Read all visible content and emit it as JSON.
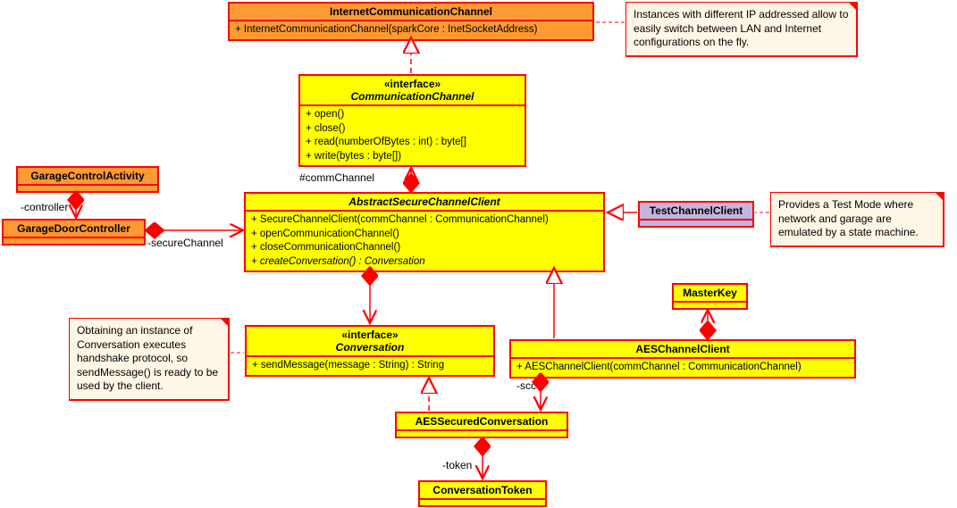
{
  "notes": {
    "ipNote": "Instances with different IP addressed allow to easily switch between LAN and Internet configurations on the fly.",
    "testNote": "Provides a Test Mode where network and garage are emulated by a state machine.",
    "convNote": "Obtaining an instance of Conversation executes handshake protocol, so sendMessage() is ready to be used by the client."
  },
  "classes": {
    "internetComm": {
      "title": "InternetCommunicationChannel",
      "m1": "+ InternetCommunicationChannel(sparkCore : InetSocketAddress)"
    },
    "commChannel": {
      "stereo": "«interface»",
      "title": "CommunicationChannel",
      "m1": "+ open()",
      "m2": "+ close()",
      "m3": "+ read(numberOfBytes : int) : byte[]",
      "m4": "+ write(bytes : byte[])"
    },
    "garageActivity": {
      "title": "GarageControlActivity"
    },
    "garageDoor": {
      "title": "GarageDoorController"
    },
    "abstractClient": {
      "title": "AbstractSecureChannelClient",
      "m1": "+ SecureChannelClient(commChannel : CommunicationChannel)",
      "m2": "+ openCommunicationChannel()",
      "m3": "+ closeCommunicationChannel()",
      "m4": "+ createConversation() : Conversation"
    },
    "testClient": {
      "title": "TestChannelClient"
    },
    "masterKey": {
      "title": "MasterKey"
    },
    "conversation": {
      "stereo": "«interface»",
      "title": "Conversation",
      "m1": "+ sendMessage(message : String) : String"
    },
    "aesClient": {
      "title": "AESChannelClient",
      "m1": "+ AESChannelClient(commChannel : CommunicationChannel)"
    },
    "aesConv": {
      "title": "AESSecuredConversation"
    },
    "convToken": {
      "title": "ConversationToken"
    }
  },
  "labels": {
    "commChannel": "#commChannel",
    "controller": "-controller",
    "secureChannel": "-secureChannel",
    "scc": "-scc",
    "token": "-token"
  }
}
